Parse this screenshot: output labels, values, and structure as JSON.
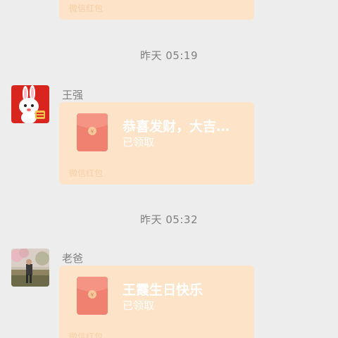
{
  "messages": [
    {
      "packet": {
        "brand": "微信红包"
      }
    },
    {
      "timestamp": "昨天 05:19",
      "sender": "王强",
      "avatar_icon": "rabbit-avatar-icon",
      "packet": {
        "greeting": "恭喜发财，大吉…",
        "status": "已领取",
        "brand": "微信红包"
      }
    },
    {
      "timestamp": "昨天 05:32",
      "sender": "老爸",
      "avatar_icon": "photo-avatar-icon",
      "packet": {
        "greeting": "王霞生日快乐",
        "status": "已领取",
        "brand": "微信红包"
      }
    }
  ],
  "colors": {
    "background": "#ededed",
    "packet_bubble": "#fde3c7",
    "packet_envelope": "#f08070",
    "packet_coin": "#f5c89a"
  }
}
